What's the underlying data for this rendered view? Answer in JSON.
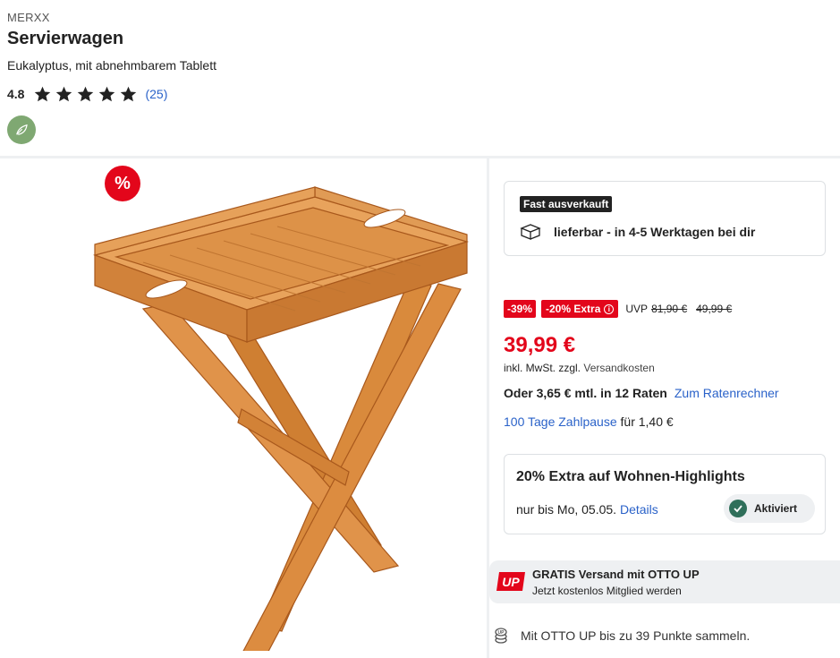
{
  "brand": "MERXX",
  "title": "Servierwagen",
  "subtitle": "Eukalyptus, mit abnehmbarem Tablett",
  "rating": {
    "value": "4.8",
    "stars": 5,
    "count": "(25)"
  },
  "sale_badge": "%",
  "delivery": {
    "badge": "Fast ausverkauft",
    "text": "lieferbar - in 4-5 Werktagen bei dir"
  },
  "pricing": {
    "discount": "-39%",
    "extra": "-20% Extra",
    "uvp_label": "UVP",
    "uvp_value": "81,90 €",
    "old_price": "49,99 €",
    "current": "39,99 €",
    "tax_prefix": "inkl. MwSt. zzgl.",
    "tax_link": "Versandkosten",
    "installment_text": "Oder 3,65 € mtl. in 12 Raten",
    "installment_link": "Zum Ratenrechner",
    "pause_link": "100 Tage Zahlpause",
    "pause_suffix": "für 1,40 €"
  },
  "promo": {
    "title": "20% Extra auf Wohnen-Highlights",
    "until_prefix": "nur bis Mo, 05.05.",
    "details_link": "Details",
    "status": "Aktiviert"
  },
  "otto_up": {
    "logo": "UP",
    "title": "GRATIS Versand mit OTTO UP",
    "subtitle": "Jetzt kostenlos Mitglied werden"
  },
  "points": {
    "text": "Mit OTTO UP bis zu 39 Punkte sammeln."
  },
  "colors": {
    "sale_red": "#e3061b",
    "link_blue": "#2a62c9",
    "eco_green": "#7fa872",
    "check_green": "#2f6f5a",
    "wood": "#d98a3c"
  }
}
